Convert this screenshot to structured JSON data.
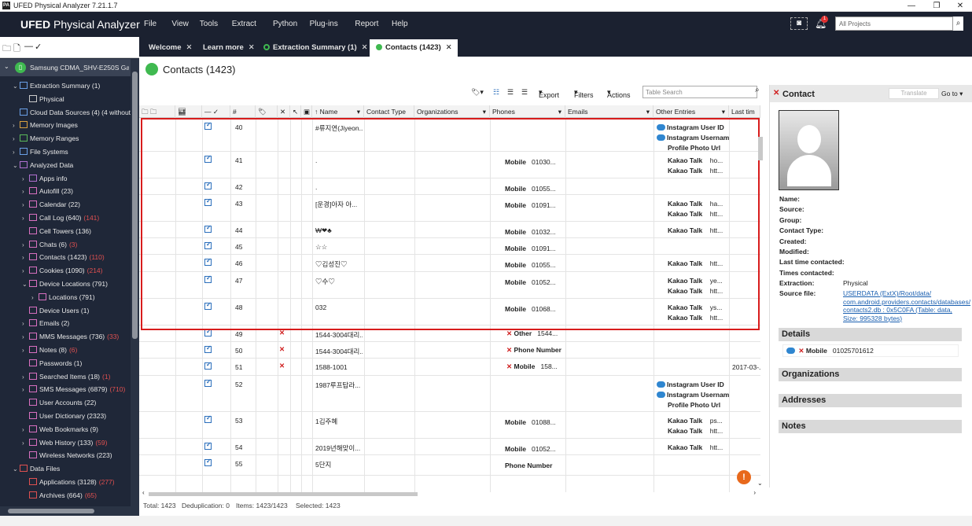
{
  "window": {
    "title": "UFED Physical Analyzer 7.21.1.7"
  },
  "app": {
    "brand_bold": "UFED",
    "brand_rest": "Physical Analyzer",
    "menus": [
      "File",
      "View",
      "Tools",
      "Extract",
      "Python",
      "Plug-ins",
      "Report",
      "Help"
    ],
    "notif_count": "1",
    "project_placeholder": "All Projects"
  },
  "tabs": [
    {
      "label": "Welcome"
    },
    {
      "label": "Learn more"
    },
    {
      "label": "Extraction Summary (1)"
    },
    {
      "label": "Contacts (1423)"
    }
  ],
  "tree": {
    "device": "Samsung CDMA_SHV-E250S Galaxy",
    "items": [
      {
        "label": "Extraction Summary (1)",
        "indent": 1,
        "arrow": "⌄",
        "color": "#6aa0e8"
      },
      {
        "label": "Physical",
        "indent": 2,
        "arrow": "",
        "color": "#cccccc"
      },
      {
        "label": "Cloud Data Sources (4)  (4 without ...",
        "indent": 1,
        "arrow": "",
        "color": "#6aa0e8"
      },
      {
        "label": "Memory Images",
        "indent": 1,
        "arrow": "›",
        "color": "#d8a040"
      },
      {
        "label": "Memory Ranges",
        "indent": 1,
        "arrow": "›",
        "color": "#5ab85a"
      },
      {
        "label": "File Systems",
        "indent": 1,
        "arrow": "›",
        "color": "#6aa0e8"
      },
      {
        "label": "Analyzed Data",
        "indent": 1,
        "arrow": "⌄",
        "color": "#b070d0"
      },
      {
        "label": "Apps info",
        "indent": 2,
        "arrow": "›",
        "color": "#b070d0"
      },
      {
        "label": "Autofill (23)",
        "indent": 2,
        "arrow": "›",
        "color": "#d870c0"
      },
      {
        "label": "Calendar (22)",
        "indent": 2,
        "arrow": "›",
        "color": "#d870c0"
      },
      {
        "label": "Call Log (640)",
        "red": "(141)",
        "indent": 2,
        "arrow": "›",
        "color": "#d870c0"
      },
      {
        "label": "Cell Towers (136)",
        "indent": 2,
        "arrow": "",
        "color": "#d870c0"
      },
      {
        "label": "Chats (6)",
        "red": "(3)",
        "indent": 2,
        "arrow": "›",
        "color": "#d870c0"
      },
      {
        "label": "Contacts (1423)",
        "red": "(110)",
        "indent": 2,
        "arrow": "›",
        "color": "#d870c0"
      },
      {
        "label": "Cookies (1090)",
        "red": "(214)",
        "indent": 2,
        "arrow": "›",
        "color": "#d870c0"
      },
      {
        "label": "Device Locations (791)",
        "indent": 2,
        "arrow": "⌄",
        "color": "#d870c0"
      },
      {
        "label": "Locations (791)",
        "indent": 3,
        "arrow": "›",
        "color": "#d870c0"
      },
      {
        "label": "Device Users (1)",
        "indent": 2,
        "arrow": "",
        "color": "#d870c0"
      },
      {
        "label": "Emails (2)",
        "indent": 2,
        "arrow": "›",
        "color": "#d870c0"
      },
      {
        "label": "MMS Messages (736)",
        "red": "(33)",
        "indent": 2,
        "arrow": "›",
        "color": "#d870c0"
      },
      {
        "label": "Notes (8)",
        "red": "(6)",
        "indent": 2,
        "arrow": "›",
        "color": "#d870c0"
      },
      {
        "label": "Passwords (1)",
        "indent": 2,
        "arrow": "",
        "color": "#d870c0"
      },
      {
        "label": "Searched Items (18)",
        "red": "(1)",
        "indent": 2,
        "arrow": "›",
        "color": "#d870c0"
      },
      {
        "label": "SMS Messages (6879)",
        "red": "(710)",
        "indent": 2,
        "arrow": "›",
        "color": "#d870c0"
      },
      {
        "label": "User Accounts (22)",
        "indent": 2,
        "arrow": "",
        "color": "#d870c0"
      },
      {
        "label": "User Dictionary (2323)",
        "indent": 2,
        "arrow": "",
        "color": "#d870c0"
      },
      {
        "label": "Web Bookmarks (9)",
        "indent": 2,
        "arrow": "›",
        "color": "#d870c0"
      },
      {
        "label": "Web History (133)",
        "red": "(59)",
        "indent": 2,
        "arrow": "›",
        "color": "#d870c0"
      },
      {
        "label": "Wireless Networks (223)",
        "indent": 2,
        "arrow": "",
        "color": "#d870c0"
      },
      {
        "label": "Data Files",
        "indent": 1,
        "arrow": "⌄",
        "color": "#e05050"
      },
      {
        "label": "Applications (3128)",
        "red": "(277)",
        "indent": 2,
        "arrow": "",
        "color": "#e05050"
      },
      {
        "label": "Archives (664)",
        "red": "(65)",
        "indent": 2,
        "arrow": "",
        "color": "#e05050"
      }
    ]
  },
  "page": {
    "title": "Contacts",
    "count": "(1423)"
  },
  "toolbar": {
    "export": "Export",
    "filters": "Filters",
    "actions": "Actions",
    "search_placeholder": "Table Search"
  },
  "columns": {
    "num": "#",
    "name": "Name",
    "contact_type": "Contact Type",
    "organizations": "Organizations",
    "phones": "Phones",
    "emails": "Emails",
    "other": "Other Entries",
    "last": "Last tim"
  },
  "rows": [
    {
      "n": "40",
      "name": "#류지연(Jiyeon...",
      "phone_lbl": "",
      "phone": "",
      "other": [
        [
          "cloud",
          "Instagram User ID",
          ""
        ],
        [
          "cloud",
          "Instagram Username",
          ""
        ],
        [
          "",
          "Profile Photo Url",
          ""
        ]
      ],
      "x": false,
      "h": 42
    },
    {
      "n": "41",
      "name": ".",
      "phone_lbl": "Mobile",
      "phone": "01030...",
      "other": [
        [
          "",
          "Kakao Talk",
          "ho..."
        ],
        [
          "",
          "Kakao Talk",
          "htt..."
        ]
      ],
      "x": false,
      "h": 34
    },
    {
      "n": "42",
      "name": ".",
      "phone_lbl": "Mobile",
      "phone": "01055...",
      "other": [],
      "x": false,
      "h": 21
    },
    {
      "n": "43",
      "name": "[운경]아자 아...",
      "phone_lbl": "Mobile",
      "phone": "01091...",
      "other": [
        [
          "",
          "Kakao Talk",
          "ha..."
        ],
        [
          "",
          "Kakao Talk",
          "htt..."
        ]
      ],
      "x": false,
      "h": 34
    },
    {
      "n": "44",
      "name": "₩❤♣",
      "phone_lbl": "Mobile",
      "phone": "01032...",
      "other": [
        [
          "",
          "Kakao Talk",
          "htt..."
        ]
      ],
      "x": false,
      "h": 21
    },
    {
      "n": "45",
      "name": "☆☆",
      "phone_lbl": "Mobile",
      "phone": "01091...",
      "other": [],
      "x": false,
      "h": 21
    },
    {
      "n": "46",
      "name": "♡김성진♡",
      "phone_lbl": "Mobile",
      "phone": "01055...",
      "other": [
        [
          "",
          "Kakao Talk",
          "htt..."
        ]
      ],
      "x": false,
      "h": 22
    },
    {
      "n": "47",
      "name": "♡수♡",
      "phone_lbl": "Mobile",
      "phone": "01052...",
      "other": [
        [
          "",
          "Kakao Talk",
          "ye..."
        ],
        [
          "",
          "Kakao Talk",
          "htt..."
        ]
      ],
      "x": false,
      "h": 34
    },
    {
      "n": "48",
      "name": "032",
      "phone_lbl": "Mobile",
      "phone": "01068...",
      "other": [
        [
          "",
          "Kakao Talk",
          "ys..."
        ],
        [
          "",
          "Kakao Talk",
          "htt..."
        ]
      ],
      "x": false,
      "h": 34
    },
    {
      "n": "49",
      "name": "1544-3004대리...",
      "phone_lbl": "Other",
      "phone": "1544...",
      "phone_x": true,
      "other": [],
      "x": true,
      "h": 21
    },
    {
      "n": "50",
      "name": "1544-3004대리...",
      "phone_lbl": "Phone Number",
      "phone": "",
      "phone_x": true,
      "other": [],
      "x": true,
      "h": 21
    },
    {
      "n": "51",
      "name": "1588-1001",
      "phone_lbl": "Mobile",
      "phone": "158...",
      "phone_x": true,
      "other": [],
      "x": true,
      "h": 22,
      "last": "2017-03-..."
    },
    {
      "n": "52",
      "name": "1987루프탑라...",
      "phone_lbl": "",
      "phone": "",
      "other": [
        [
          "cloud",
          "Instagram User ID",
          ""
        ],
        [
          "cloud",
          "Instagram Username",
          ""
        ],
        [
          "",
          "Profile Photo Url",
          ""
        ]
      ],
      "x": false,
      "h": 46
    },
    {
      "n": "53",
      "name": "1김주혜",
      "phone_lbl": "Mobile",
      "phone": "01088...",
      "other": [
        [
          "",
          "Kakao Talk",
          "ps..."
        ],
        [
          "",
          "Kakao Talk",
          "htt..."
        ]
      ],
      "x": false,
      "h": 34
    },
    {
      "n": "54",
      "name": "2019년해맞이...",
      "phone_lbl": "Mobile",
      "phone": "01052...",
      "other": [
        [
          "",
          "Kakao Talk",
          "htt..."
        ]
      ],
      "x": false,
      "h": 21
    },
    {
      "n": "55",
      "name": "5단지",
      "phone_lbl": "Phone Number",
      "phone": "",
      "other": [],
      "x": false,
      "h": 26
    }
  ],
  "status": {
    "total": "Total: 1423",
    "dedup": "Deduplication: 0",
    "items": "Items: 1423/1423",
    "selected": "Selected: 1423"
  },
  "detail": {
    "title": "Contact",
    "translate": "Translate",
    "goto": "Go to",
    "fields": [
      {
        "k": "Name:",
        "v": ""
      },
      {
        "k": "Source:",
        "v": ""
      },
      {
        "k": "Group:",
        "v": ""
      },
      {
        "k": "Contact Type:",
        "v": ""
      },
      {
        "k": "Created:",
        "v": ""
      },
      {
        "k": "Modified:",
        "v": ""
      },
      {
        "k": "Last time contacted:",
        "v": ""
      },
      {
        "k": "Times contacted:",
        "v": ""
      },
      {
        "k": "Extraction:",
        "v": "Physical"
      }
    ],
    "source_file_label": "Source file:",
    "source_file": "USERDATA (ExtX)/Root/data/ com.android.providers.contacts/databases/ contacts2.db : 0x5C0FA (Table: data, Size: 995328 bytes)",
    "sections": {
      "details": "Details",
      "organizations": "Organizations",
      "addresses": "Addresses",
      "notes": "Notes"
    },
    "detail_phone_label": "Mobile",
    "detail_phone": "01025701612"
  }
}
